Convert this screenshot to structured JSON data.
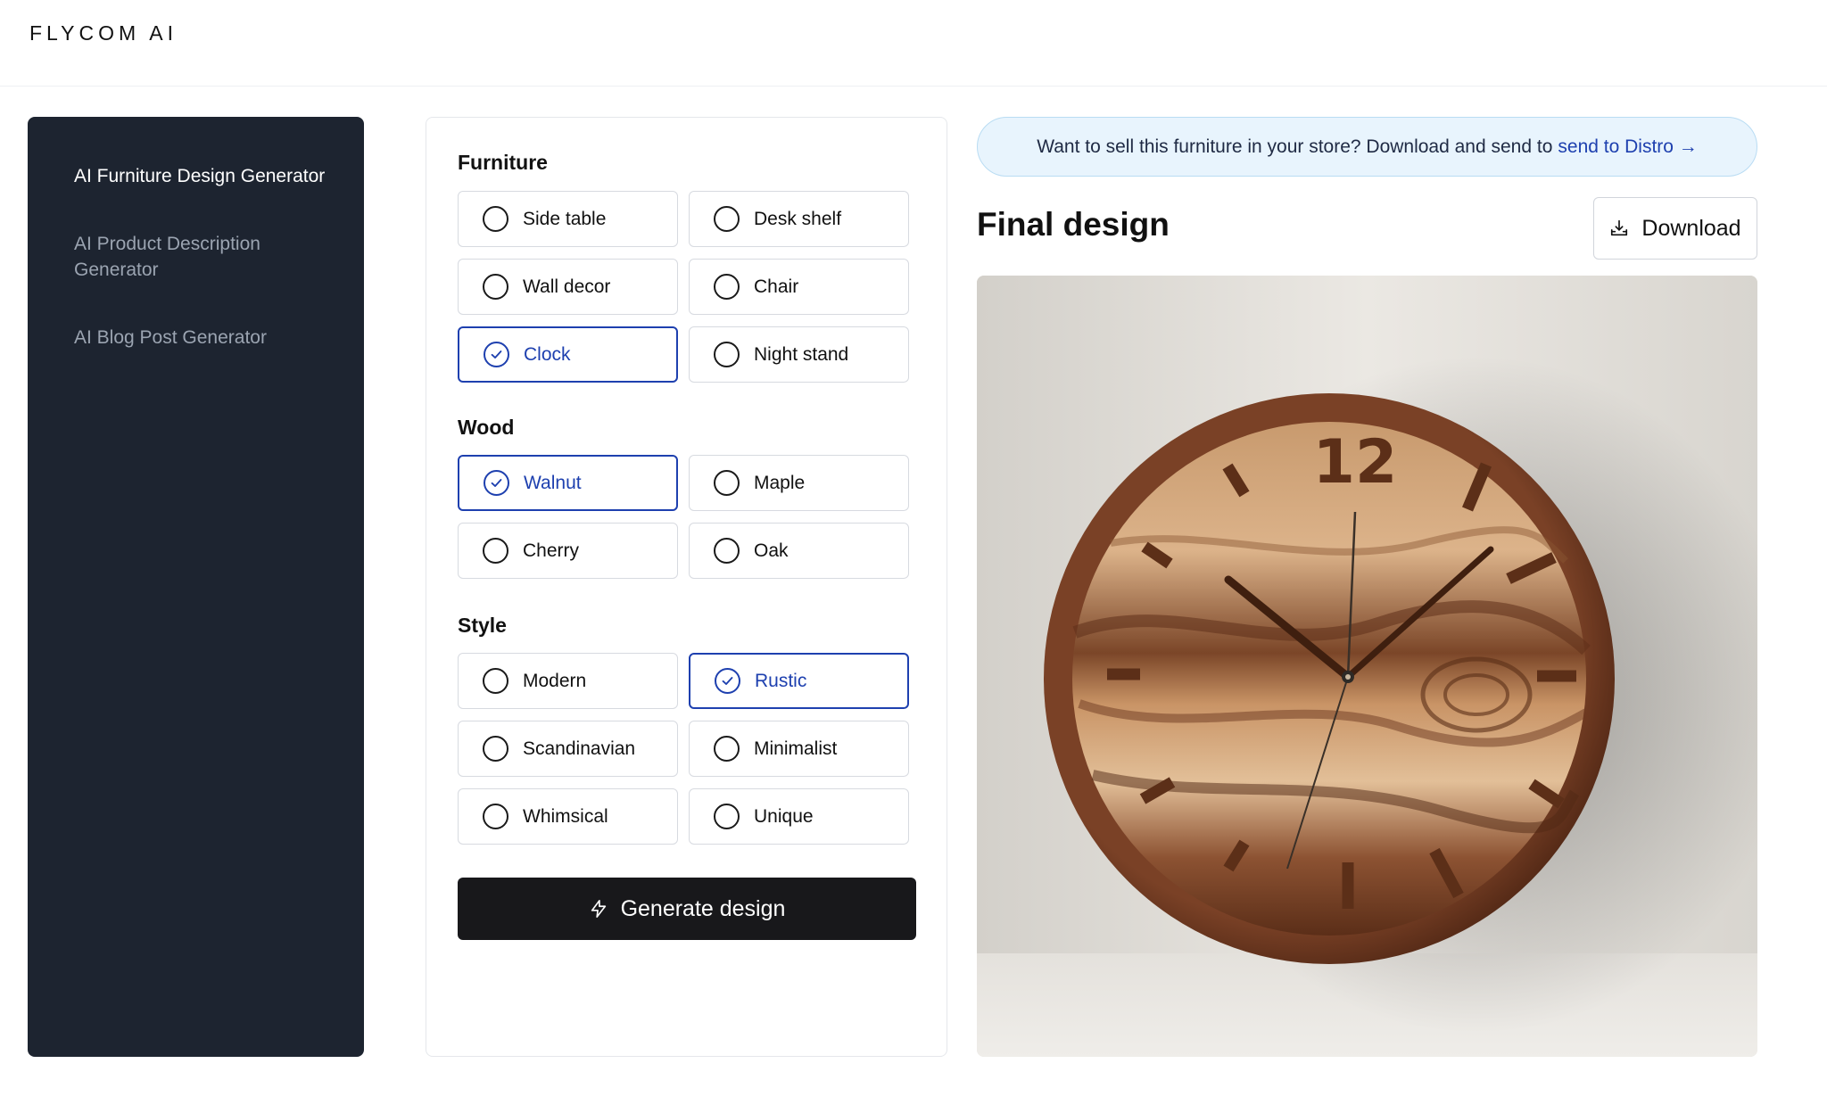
{
  "header": {
    "logo": "FLYCOM AI"
  },
  "sidebar": {
    "items": [
      {
        "label": "AI Furniture Design Generator"
      },
      {
        "label": "AI Product Description Generator"
      },
      {
        "label": "AI Blog Post Generator"
      }
    ]
  },
  "form": {
    "furniture": {
      "title": "Furniture",
      "options": [
        "Side table",
        "Desk shelf",
        "Wall decor",
        "Chair",
        "Clock",
        "Night stand"
      ],
      "selected": "Clock"
    },
    "wood": {
      "title": "Wood",
      "options": [
        "Walnut",
        "Maple",
        "Cherry",
        "Oak"
      ],
      "selected": "Walnut"
    },
    "style": {
      "title": "Style",
      "options": [
        "Modern",
        "Rustic",
        "Scandinavian",
        "Minimalist",
        "Whimsical",
        "Unique"
      ],
      "selected": "Rustic"
    },
    "generate_label": "Generate design"
  },
  "banner": {
    "text": "Want to sell this furniture in your store? Download and send to",
    "link": "send to Distro →"
  },
  "result": {
    "title": "Final design",
    "download_label": "Download",
    "image": {
      "subject": "walnut wall clock",
      "clock_numeral": "12"
    }
  },
  "colors": {
    "sidebar_bg": "#1d2430",
    "accent": "#1e40af",
    "button_bg": "#18181b",
    "banner_bg": "#e8f4fd"
  },
  "icons": [
    "check-circle-icon",
    "radio-icon",
    "bolt-icon",
    "download-icon"
  ]
}
